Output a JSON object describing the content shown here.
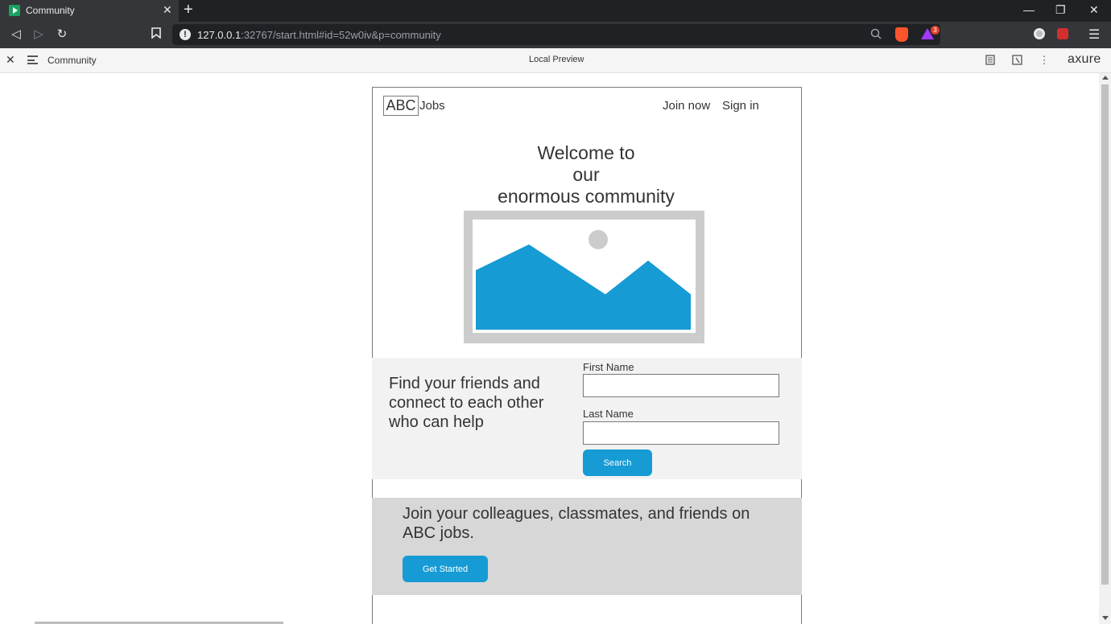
{
  "browser": {
    "tab_title": "Community",
    "url_host": "127.0.0.1",
    "url_rest": ":32767/start.html#id=52w0iv&p=community",
    "rewards_badge": "3"
  },
  "axure": {
    "page_name": "Community",
    "center_label": "Local Preview",
    "logo": "axure"
  },
  "header": {
    "logo_box": "ABC",
    "logo_text": "Jobs",
    "join_now": "Join now",
    "sign_in": "Sign in"
  },
  "hero": {
    "welcome_line1": "Welcome to",
    "welcome_line2": "our",
    "welcome_line3": "enormous community"
  },
  "find": {
    "heading": "Find your friends and connect to each other who can help",
    "first_name_label": "First Name",
    "first_name_value": "",
    "last_name_label": "Last Name",
    "last_name_value": "",
    "search_button": "Search"
  },
  "join": {
    "heading": "Join your colleagues, classmates, and friends on ABC jobs.",
    "get_started_button": "Get Started"
  },
  "colors": {
    "accent": "#169bd5",
    "find_bg": "#f2f2f2",
    "join_bg": "#d7d7d7",
    "image_frame": "#cccccc"
  }
}
